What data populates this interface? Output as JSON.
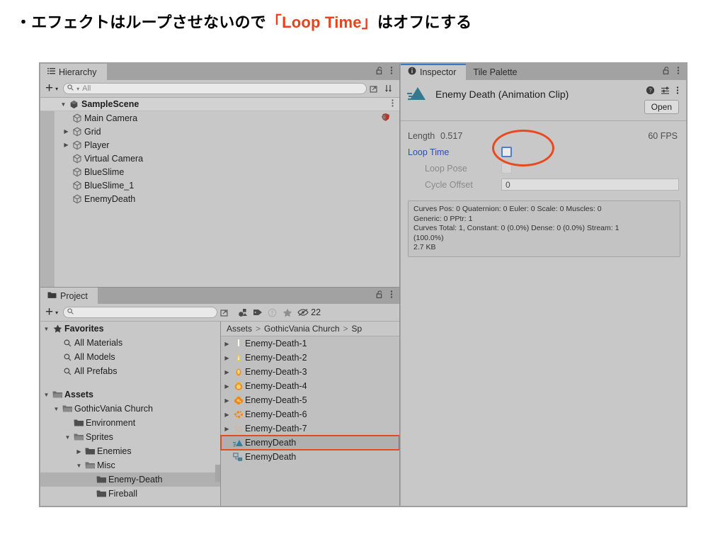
{
  "heading": {
    "prefix": "・エフェクトはループさせないので",
    "highlight": "「Loop Time」",
    "suffix": "はオフにする",
    "highlight_color": "#e8421c"
  },
  "hierarchy": {
    "tab_label": "Hierarchy",
    "tab_icon": "hierarchy-list-icon",
    "lock_icon": "lock-open-icon",
    "menu_icon": "kebab-menu-icon",
    "toolbar": {
      "add_label": "+",
      "dropdown_caret": "▾",
      "search_placeholder": "All",
      "search_icon": "search-icon",
      "picker_icon": "picker-icon",
      "sort_icon": "sort-icon"
    },
    "scene": {
      "name": "SampleScene",
      "expand_arrow": "▼",
      "icon": "unity-scene-icon",
      "menu_icon": "kebab-menu-icon"
    },
    "items": [
      {
        "label": "Main Camera",
        "arrow": "",
        "icon": "gameobject-icon",
        "badge": "effect-icon"
      },
      {
        "label": "Grid",
        "arrow": "▶",
        "icon": "gameobject-icon",
        "badge": ""
      },
      {
        "label": "Player",
        "arrow": "▶",
        "icon": "gameobject-icon",
        "badge": ""
      },
      {
        "label": "Virtual Camera",
        "arrow": "",
        "icon": "gameobject-icon",
        "badge": ""
      },
      {
        "label": "BlueSlime",
        "arrow": "",
        "icon": "gameobject-icon",
        "badge": ""
      },
      {
        "label": "BlueSlime_1",
        "arrow": "",
        "icon": "gameobject-icon",
        "badge": ""
      },
      {
        "label": "EnemyDeath",
        "arrow": "",
        "icon": "gameobject-icon",
        "badge": ""
      }
    ]
  },
  "inspector": {
    "tabs": [
      {
        "label": "Inspector",
        "icon": "info-icon",
        "active": true
      },
      {
        "label": "Tile Palette",
        "icon": "",
        "active": false
      }
    ],
    "lock_icon": "lock-open-icon",
    "menu_icon": "kebab-menu-icon",
    "asset_icon": "animation-clip-icon",
    "asset_title": "Enemy Death (Animation Clip)",
    "help_icon": "help-icon",
    "preset_icon": "preset-icon",
    "more_icon": "kebab-menu-icon",
    "open_button": "Open",
    "properties": {
      "length_label": "Length",
      "length_value": "0.517",
      "fps_value": "60 FPS",
      "loop_time_label": "Loop Time",
      "loop_time_checked": false,
      "loop_pose_label": "Loop Pose",
      "loop_pose_checked": false,
      "cycle_offset_label": "Cycle Offset",
      "cycle_offset_value": "0"
    },
    "highlight_color": "#e8491f",
    "curves_info": [
      "Curves Pos: 0 Quaternion: 0 Euler: 0 Scale: 0 Muscles: 0",
      "Generic: 0 PPtr: 1",
      "Curves Total: 1, Constant: 0 (0.0%) Dense: 0 (0.0%) Stream: 1",
      "(100.0%)",
      "2.7 KB"
    ]
  },
  "project": {
    "tab_label": "Project",
    "tab_icon": "folder-icon",
    "lock_icon": "lock-open-icon",
    "menu_icon": "kebab-menu-icon",
    "toolbar": {
      "add_label": "+",
      "dropdown_caret": "▾",
      "search_placeholder": "",
      "search_icon": "search-icon",
      "picker_icon": "picker-icon",
      "filter_type_icon": "filter-by-type-icon",
      "filter_label_icon": "filter-by-label-icon",
      "warning_icon": "warning-icon",
      "favorite_icon": "star-icon",
      "visibility_icon": "eye-slash-icon",
      "visibility_count": "22"
    },
    "tree": [
      {
        "label": "Favorites",
        "arrow": "▼",
        "icon": "star-icon",
        "indent": 0,
        "bold": true,
        "selected": false
      },
      {
        "label": "All Materials",
        "arrow": "",
        "icon": "search-icon",
        "indent": 1,
        "bold": false,
        "selected": false
      },
      {
        "label": "All Models",
        "arrow": "",
        "icon": "search-icon",
        "indent": 1,
        "bold": false,
        "selected": false
      },
      {
        "label": "All Prefabs",
        "arrow": "",
        "icon": "search-icon",
        "indent": 1,
        "bold": false,
        "selected": false
      },
      {
        "label": "",
        "arrow": "",
        "icon": "",
        "indent": 0,
        "bold": false,
        "selected": false
      },
      {
        "label": "Assets",
        "arrow": "▼",
        "icon": "folder-open-icon",
        "indent": 0,
        "bold": true,
        "selected": false
      },
      {
        "label": "GothicVania Church",
        "arrow": "▼",
        "icon": "folder-open-icon",
        "indent": 1,
        "bold": false,
        "selected": false
      },
      {
        "label": "Environment",
        "arrow": "",
        "icon": "folder-icon",
        "indent": 2,
        "bold": false,
        "selected": false
      },
      {
        "label": "Sprites",
        "arrow": "▼",
        "icon": "folder-open-icon",
        "indent": 2,
        "bold": false,
        "selected": false
      },
      {
        "label": "Enemies",
        "arrow": "▶",
        "icon": "folder-icon",
        "indent": 3,
        "bold": false,
        "selected": false
      },
      {
        "label": "Misc",
        "arrow": "▼",
        "icon": "folder-open-icon",
        "indent": 3,
        "bold": false,
        "selected": false
      },
      {
        "label": "Enemy-Death",
        "arrow": "",
        "icon": "folder-icon",
        "indent": 4,
        "bold": false,
        "selected": true
      },
      {
        "label": "Fireball",
        "arrow": "",
        "icon": "folder-icon",
        "indent": 4,
        "bold": false,
        "selected": false
      }
    ],
    "breadcrumb": [
      "Assets",
      "GothicVania Church",
      "Sp"
    ],
    "breadcrumb_separator": ">",
    "assets": [
      {
        "label": "Enemy-Death-1",
        "arrow": "▶",
        "icon": "sprite-icon",
        "selected": false,
        "boxed": false
      },
      {
        "label": "Enemy-Death-2",
        "arrow": "▶",
        "icon": "sprite-icon",
        "selected": false,
        "boxed": false
      },
      {
        "label": "Enemy-Death-3",
        "arrow": "▶",
        "icon": "sprite-icon",
        "selected": false,
        "boxed": false
      },
      {
        "label": "Enemy-Death-4",
        "arrow": "▶",
        "icon": "sprite-icon",
        "selected": false,
        "boxed": false
      },
      {
        "label": "Enemy-Death-5",
        "arrow": "▶",
        "icon": "sprite-icon",
        "selected": false,
        "boxed": false
      },
      {
        "label": "Enemy-Death-6",
        "arrow": "▶",
        "icon": "sprite-icon",
        "selected": false,
        "boxed": false
      },
      {
        "label": "Enemy-Death-7",
        "arrow": "▶",
        "icon": "sprite-icon",
        "selected": false,
        "boxed": false
      },
      {
        "label": "EnemyDeath",
        "arrow": "",
        "icon": "animation-clip-icon",
        "selected": true,
        "boxed": true
      },
      {
        "label": "EnemyDeath",
        "arrow": "",
        "icon": "animator-controller-icon",
        "selected": false,
        "boxed": false
      }
    ]
  }
}
